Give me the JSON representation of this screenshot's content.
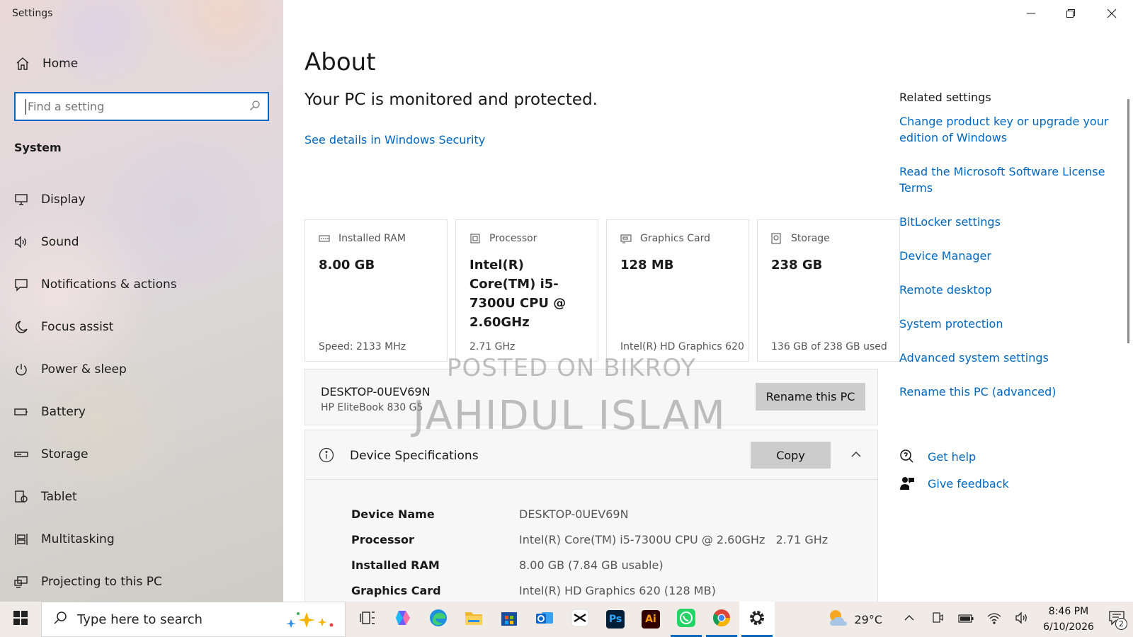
{
  "window": {
    "title": "Settings",
    "controls": {
      "minimize": "minimize",
      "restore": "restore",
      "close": "close"
    }
  },
  "sidebar": {
    "home_label": "Home",
    "search_placeholder": "Find a setting",
    "section_title": "System",
    "items": [
      {
        "label": "Display",
        "icon": "monitor-icon"
      },
      {
        "label": "Sound",
        "icon": "speaker-icon"
      },
      {
        "label": "Notifications & actions",
        "icon": "message-icon"
      },
      {
        "label": "Focus assist",
        "icon": "moon-icon"
      },
      {
        "label": "Power & sleep",
        "icon": "power-icon"
      },
      {
        "label": "Battery",
        "icon": "battery-icon"
      },
      {
        "label": "Storage",
        "icon": "storage-icon"
      },
      {
        "label": "Tablet",
        "icon": "tablet-icon"
      },
      {
        "label": "Multitasking",
        "icon": "multitasking-icon"
      },
      {
        "label": "Projecting to this PC",
        "icon": "projecting-icon"
      }
    ]
  },
  "main": {
    "title": "About",
    "protection_status": "Your PC is monitored and protected.",
    "security_link": "See details in Windows Security",
    "cards": [
      {
        "label": "Installed RAM",
        "value": "8.00 GB",
        "sub": "Speed: 2133 MHz",
        "icon": "ram-icon"
      },
      {
        "label": "Processor",
        "value": "Intel(R) Core(TM) i5-7300U CPU @ 2.60GHz",
        "sub": "2.71 GHz",
        "icon": "processor-icon"
      },
      {
        "label": "Graphics Card",
        "value": "128 MB",
        "sub": "Intel(R) HD Graphics 620",
        "icon": "graphics-card-icon"
      },
      {
        "label": "Storage",
        "value": "238 GB",
        "sub": "136 GB of 238 GB used",
        "icon": "storage-drive-icon"
      }
    ],
    "pc": {
      "name": "DESKTOP-0UEV69N",
      "model": "HP EliteBook 830 G5",
      "rename_label": "Rename this PC"
    },
    "specs": {
      "title": "Device Specifications",
      "copy_label": "Copy",
      "rows": [
        {
          "key": "Device Name",
          "value": "DESKTOP-0UEV69N"
        },
        {
          "key": "Processor",
          "value": "Intel(R) Core(TM) i5-7300U CPU @ 2.60GHz   2.71 GHz"
        },
        {
          "key": "Installed RAM",
          "value": "8.00 GB (7.84 GB usable)"
        },
        {
          "key": "Graphics Card",
          "value": "Intel(R) HD Graphics 620 (128 MB)"
        }
      ]
    },
    "related": {
      "title": "Related settings",
      "links": [
        "Change product key or upgrade your edition of Windows",
        "Read the Microsoft Software License Terms",
        "BitLocker settings",
        "Device Manager",
        "Remote desktop",
        "System protection",
        "Advanced system settings",
        "Rename this PC (advanced)"
      ]
    },
    "help": {
      "get_help": "Get help",
      "give_feedback": "Give feedback"
    },
    "watermark": {
      "line1": "POSTED ON BIKROY",
      "line2": "JAHIDUL ISLAM"
    }
  },
  "taskbar": {
    "search_placeholder": "Type here to search",
    "weather": "29°C",
    "time": "8:46 PM",
    "date": "6/10/2026",
    "notification_count": "2",
    "apps": [
      {
        "name": "task-view-icon"
      },
      {
        "name": "copilot-icon"
      },
      {
        "name": "edge-icon"
      },
      {
        "name": "file-explorer-icon"
      },
      {
        "name": "microsoft-store-icon"
      },
      {
        "name": "outlook-icon"
      },
      {
        "name": "capcut-icon"
      },
      {
        "name": "photoshop-icon",
        "label": "Ps"
      },
      {
        "name": "illustrator-icon",
        "label": "Ai"
      },
      {
        "name": "whatsapp-icon"
      },
      {
        "name": "chrome-icon"
      },
      {
        "name": "settings-icon"
      }
    ]
  },
  "colors": {
    "accent": "#0067c0",
    "button_bg": "#cccccc",
    "panel_bg": "#f7f7f7",
    "taskbar_bg": "#f0ebe6"
  }
}
